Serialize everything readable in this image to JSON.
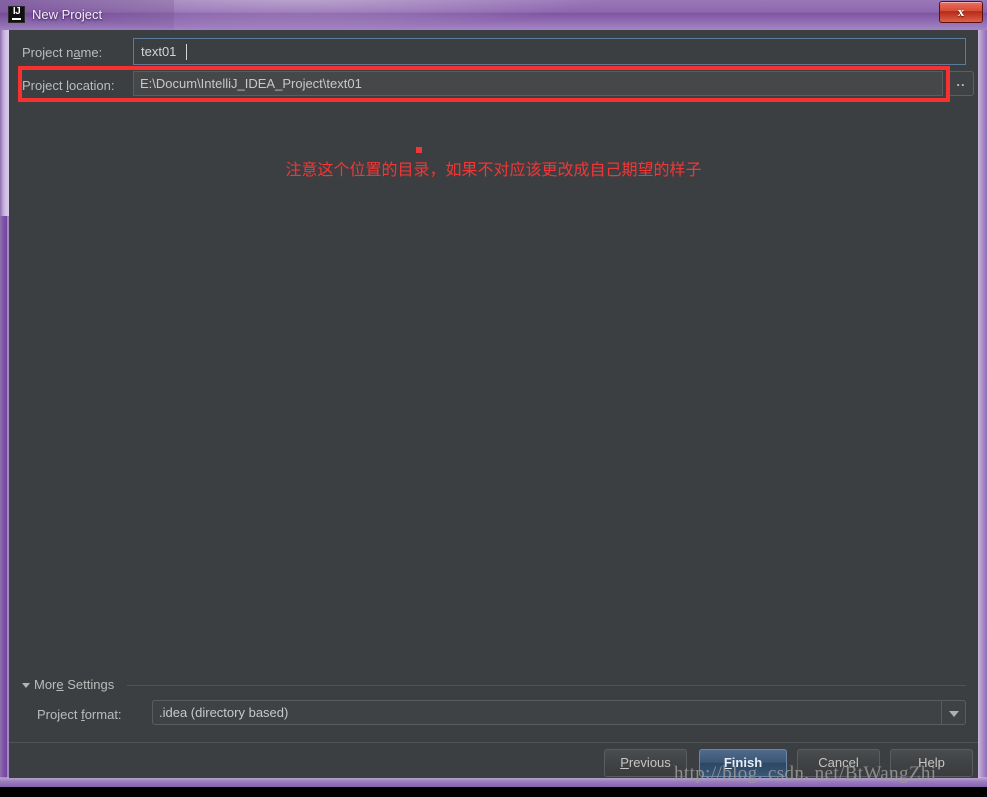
{
  "window": {
    "title": "New Project",
    "app_icon": "intellij-idea-icon",
    "close_glyph": "x",
    "titlebar_color": "#8d66ae",
    "body_color": "#3c3f41"
  },
  "form": {
    "project_name": {
      "label_before": "Project n",
      "label_mnemonic": "a",
      "label_after": "me:",
      "value": "text01"
    },
    "project_location": {
      "label_before": "Project ",
      "label_mnemonic": "l",
      "label_after": "ocation:",
      "value": "E:\\Docum\\IntelliJ_IDEA_Project\\text01"
    },
    "browse_button_label": ".."
  },
  "annotation": {
    "text": "注意这个位置的目录，如果不对应该更改成自己期望的样子",
    "color": "#f03636",
    "box_color": "#f73030"
  },
  "more_settings": {
    "label_before": "Mor",
    "label_mnemonic": "e",
    "label_after": " Settings",
    "expanded": true,
    "project_format": {
      "label_before": "Project ",
      "label_mnemonic": "f",
      "label_after": "ormat:",
      "selected": ".idea (directory based)"
    }
  },
  "footer": {
    "buttons": [
      {
        "label_before": "",
        "label_mnemonic": "P",
        "label_after": "revious",
        "name": "previous"
      },
      {
        "label_before": "",
        "label_mnemonic": "F",
        "label_after": "inish",
        "name": "finish"
      },
      {
        "label_before": "Cancel",
        "label_mnemonic": "",
        "label_after": "",
        "name": "cancel"
      },
      {
        "label_before": "Help",
        "label_mnemonic": "",
        "label_after": "",
        "name": "help"
      }
    ]
  },
  "watermark": {
    "text": "http://blog. csdn. net/BtWangZhi"
  }
}
